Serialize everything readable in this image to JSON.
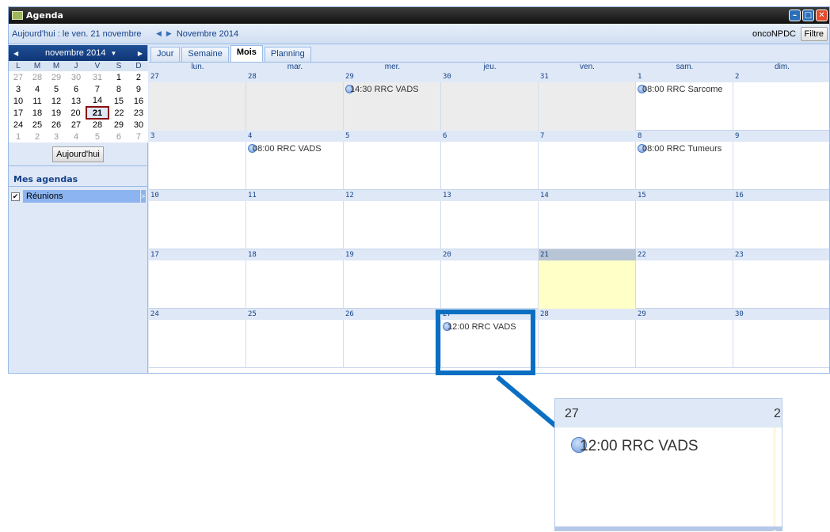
{
  "window": {
    "title": "Agenda",
    "minimize_icon": "minimize-icon",
    "maximize_icon": "maximize-icon",
    "close_icon": "close-icon"
  },
  "toolbar": {
    "today_text": "Aujourd'hui : le ven. 21 novembre",
    "month_title": "Novembre 2014",
    "user": "oncoNPDC",
    "filter_label": "Filtre"
  },
  "mini_calendar": {
    "title": "novembre 2014",
    "weekdays": [
      "L",
      "M",
      "M",
      "J",
      "V",
      "S",
      "D"
    ],
    "weeks": [
      [
        "27",
        "28",
        "29",
        "30",
        "31",
        "1",
        "2"
      ],
      [
        "3",
        "4",
        "5",
        "6",
        "7",
        "8",
        "9"
      ],
      [
        "10",
        "11",
        "12",
        "13",
        "14",
        "15",
        "16"
      ],
      [
        "17",
        "18",
        "19",
        "20",
        "21",
        "22",
        "23"
      ],
      [
        "24",
        "25",
        "26",
        "27",
        "28",
        "29",
        "30"
      ],
      [
        "1",
        "2",
        "3",
        "4",
        "5",
        "6",
        "7"
      ]
    ],
    "selected": "21",
    "today_button": "Aujourd'hui"
  },
  "agendas": {
    "title": "Mes agendas",
    "items": [
      {
        "label": "Réunions",
        "checked": true
      }
    ]
  },
  "tabs": [
    "Jour",
    "Semaine",
    "Mois",
    "Planning"
  ],
  "active_tab": "Mois",
  "day_headers": [
    "lun.",
    "mar.",
    "mer.",
    "jeu.",
    "ven.",
    "sam.",
    "dim."
  ],
  "weeks": [
    {
      "dates": [
        "27",
        "28",
        "29",
        "30",
        "31",
        "1",
        "2"
      ],
      "events": [
        {
          "day": 2,
          "text": "14:30 RRC VADS"
        },
        {
          "day": 5,
          "text": "08:00 RRC Sarcome"
        }
      ]
    },
    {
      "dates": [
        "3",
        "4",
        "5",
        "6",
        "7",
        "8",
        "9"
      ],
      "events": [
        {
          "day": 1,
          "text": "08:00 RRC VADS"
        },
        {
          "day": 5,
          "text": "08:00 RRC Tumeurs"
        }
      ]
    },
    {
      "dates": [
        "10",
        "11",
        "12",
        "13",
        "14",
        "15",
        "16"
      ],
      "events": []
    },
    {
      "dates": [
        "17",
        "18",
        "19",
        "20",
        "21",
        "22",
        "23"
      ],
      "events": []
    },
    {
      "dates": [
        "24",
        "25",
        "26",
        "27",
        "28",
        "29",
        "30"
      ],
      "events": [
        {
          "day": 3,
          "text": "12:00 RRC VADS"
        }
      ]
    }
  ],
  "zoom": {
    "date": "27",
    "next_date": "2",
    "event": "12:00 RRC VADS"
  }
}
